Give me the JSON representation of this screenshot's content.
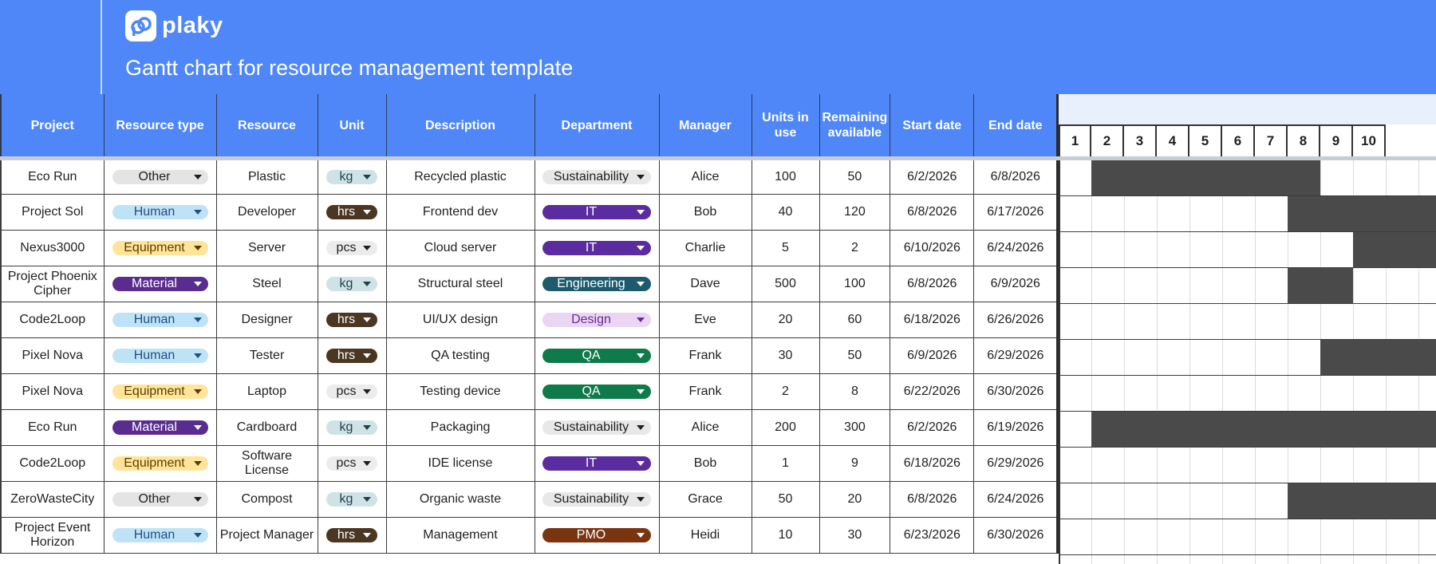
{
  "app": {
    "brand": "plaky",
    "title": "Gantt chart for resource management template"
  },
  "colors": {
    "header_blue": "#4f87f8",
    "bar": "#4a4a4a"
  },
  "columns": [
    "Project",
    "Resource type",
    "Resource",
    "Unit",
    "Description",
    "Department",
    "Manager",
    "Units in use",
    "Remaining available",
    "Start date",
    "End date"
  ],
  "timeline": {
    "days": [
      "1",
      "2",
      "3",
      "4",
      "5",
      "6",
      "7",
      "8",
      "9",
      "10"
    ]
  },
  "rows": [
    {
      "project": "Eco Run",
      "rtype": "Other",
      "resource": "Plastic",
      "unit": "kg",
      "description": "Recycled plastic",
      "department": "Sustainability",
      "manager": "Alice",
      "units_in_use": "100",
      "remaining": "50",
      "start": "6/2/2026",
      "end": "6/8/2026"
    },
    {
      "project": "Project Sol",
      "rtype": "Human",
      "resource": "Developer",
      "unit": "hrs",
      "description": "Frontend dev",
      "department": "IT",
      "manager": "Bob",
      "units_in_use": "40",
      "remaining": "120",
      "start": "6/8/2026",
      "end": "6/17/2026"
    },
    {
      "project": "Nexus3000",
      "rtype": "Equipment",
      "resource": "Server",
      "unit": "pcs",
      "description": "Cloud server",
      "department": "IT",
      "manager": "Charlie",
      "units_in_use": "5",
      "remaining": "2",
      "start": "6/10/2026",
      "end": "6/24/2026"
    },
    {
      "project": "Project Phoenix Cipher",
      "rtype": "Material",
      "resource": "Steel",
      "unit": "kg",
      "description": "Structural steel",
      "department": "Engineering",
      "manager": "Dave",
      "units_in_use": "500",
      "remaining": "100",
      "start": "6/8/2026",
      "end": "6/9/2026"
    },
    {
      "project": "Code2Loop",
      "rtype": "Human",
      "resource": "Designer",
      "unit": "hrs",
      "description": "UI/UX design",
      "department": "Design",
      "manager": "Eve",
      "units_in_use": "20",
      "remaining": "60",
      "start": "6/18/2026",
      "end": "6/26/2026"
    },
    {
      "project": "Pixel Nova",
      "rtype": "Human",
      "resource": "Tester",
      "unit": "hrs",
      "description": "QA testing",
      "department": "QA",
      "manager": "Frank",
      "units_in_use": "30",
      "remaining": "50",
      "start": "6/9/2026",
      "end": "6/29/2026"
    },
    {
      "project": "Pixel Nova",
      "rtype": "Equipment",
      "resource": "Laptop",
      "unit": "pcs",
      "description": "Testing device",
      "department": "QA",
      "manager": "Frank",
      "units_in_use": "2",
      "remaining": "8",
      "start": "6/22/2026",
      "end": "6/30/2026"
    },
    {
      "project": "Eco Run",
      "rtype": "Material",
      "resource": "Cardboard",
      "unit": "kg",
      "description": "Packaging",
      "department": "Sustainability",
      "manager": "Alice",
      "units_in_use": "200",
      "remaining": "300",
      "start": "6/2/2026",
      "end": "6/19/2026"
    },
    {
      "project": "Code2Loop",
      "rtype": "Equipment",
      "resource": "Software License",
      "unit": "pcs",
      "description": "IDE license",
      "department": "IT",
      "manager": "Bob",
      "units_in_use": "1",
      "remaining": "9",
      "start": "6/18/2026",
      "end": "6/29/2026"
    },
    {
      "project": "ZeroWasteCity",
      "rtype": "Other",
      "resource": "Compost",
      "unit": "kg",
      "description": "Organic waste",
      "department": "Sustainability",
      "manager": "Grace",
      "units_in_use": "50",
      "remaining": "20",
      "start": "6/8/2026",
      "end": "6/24/2026"
    },
    {
      "project": "Project Event Horizon",
      "rtype": "Human",
      "resource": "Project Manager",
      "unit": "hrs",
      "description": "Management",
      "department": "PMO",
      "manager": "Heidi",
      "units_in_use": "10",
      "remaining": "30",
      "start": "6/23/2026",
      "end": "6/30/2026"
    }
  ],
  "tag_styles": {
    "rtype": {
      "Other": {
        "bg": "#e4e4e4",
        "fg": "#1f1f1f"
      },
      "Human": {
        "bg": "#bfe3f6",
        "fg": "#1f4f86"
      },
      "Equipment": {
        "bg": "#ffe49a",
        "fg": "#5a3e00"
      },
      "Material": {
        "bg": "#5b2c8f",
        "fg": "#ffffff"
      }
    },
    "unit": {
      "kg": {
        "bg": "#cfe3e6",
        "fg": "#1f3f4f"
      },
      "hrs": {
        "bg": "#4b3621",
        "fg": "#ffffff"
      },
      "pcs": {
        "bg": "#ececec",
        "fg": "#1f1f1f"
      }
    },
    "department": {
      "Sustainability": {
        "bg": "#e8e8e8",
        "fg": "#1f1f1f"
      },
      "IT": {
        "bg": "#5b2ca0",
        "fg": "#ffffff"
      },
      "Engineering": {
        "bg": "#1d5a6e",
        "fg": "#ffffff"
      },
      "Design": {
        "bg": "#ead5f5",
        "fg": "#6a2a8f"
      },
      "QA": {
        "bg": "#0f7a4a",
        "fg": "#ffffff"
      },
      "PMO": {
        "bg": "#7a3410",
        "fg": "#ffffff"
      }
    }
  }
}
